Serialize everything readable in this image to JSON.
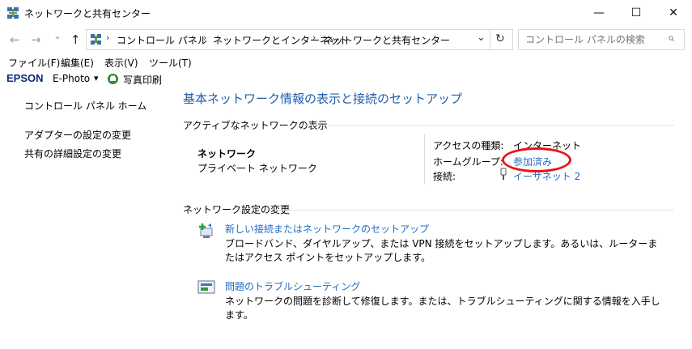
{
  "window": {
    "title": "ネットワークと共有センター",
    "min_glyph": "—",
    "max_glyph": "☐",
    "close_glyph": "✕"
  },
  "nav": {
    "back_glyph": "←",
    "forward_glyph": "→",
    "recent_glyph": "⌄",
    "up_glyph": "↑",
    "breadcrumbs": [
      "コントロール パネル",
      "ネットワークとインターネット",
      "ネットワークと共有センター"
    ],
    "sep_glyph": "›",
    "dropdown_glyph": "⌄",
    "refresh_glyph": "↻",
    "search_placeholder": "コントロール パネルの検索",
    "search_glyph": "⌕"
  },
  "menu": [
    "ファイル(F)",
    "編集(E)",
    "表示(V)",
    "ツール(T)"
  ],
  "epson": {
    "brand": "EPSON",
    "product": "E-Photo",
    "dropdown_glyph": "▾",
    "print_label": "写真印刷"
  },
  "sidebar": {
    "home": "コントロール パネル ホーム",
    "items": [
      "アダプターの設定の変更",
      "共有の詳細設定の変更"
    ]
  },
  "main": {
    "heading": "基本ネットワーク情報の表示と接続のセットアップ",
    "active_section": "アクティブなネットワークの表示",
    "network_name": "ネットワーク",
    "network_type": "プライベート ネットワーク",
    "access_label": "アクセスの種類:",
    "access_value": "インターネット",
    "homegroup_label": "ホームグループ:",
    "homegroup_value": "参加済み",
    "connection_label": "接続:",
    "connection_value": "イーサネット 2",
    "change_section": "ネットワーク設定の変更",
    "tasks": [
      {
        "title": "新しい接続またはネットワークのセットアップ",
        "description": "ブロードバンド、ダイヤルアップ、または VPN 接続をセットアップします。あるいは、ルーターまたはアクセス ポイントをセットアップします。"
      },
      {
        "title": "問題のトラブルシューティング",
        "description": "ネットワークの問題を診断して修復します。または、トラブルシューティングに関する情報を入手します。"
      }
    ]
  },
  "colors": {
    "link": "#1e6cc6",
    "heading": "#1e5dab",
    "annotation": "#e8151b"
  }
}
